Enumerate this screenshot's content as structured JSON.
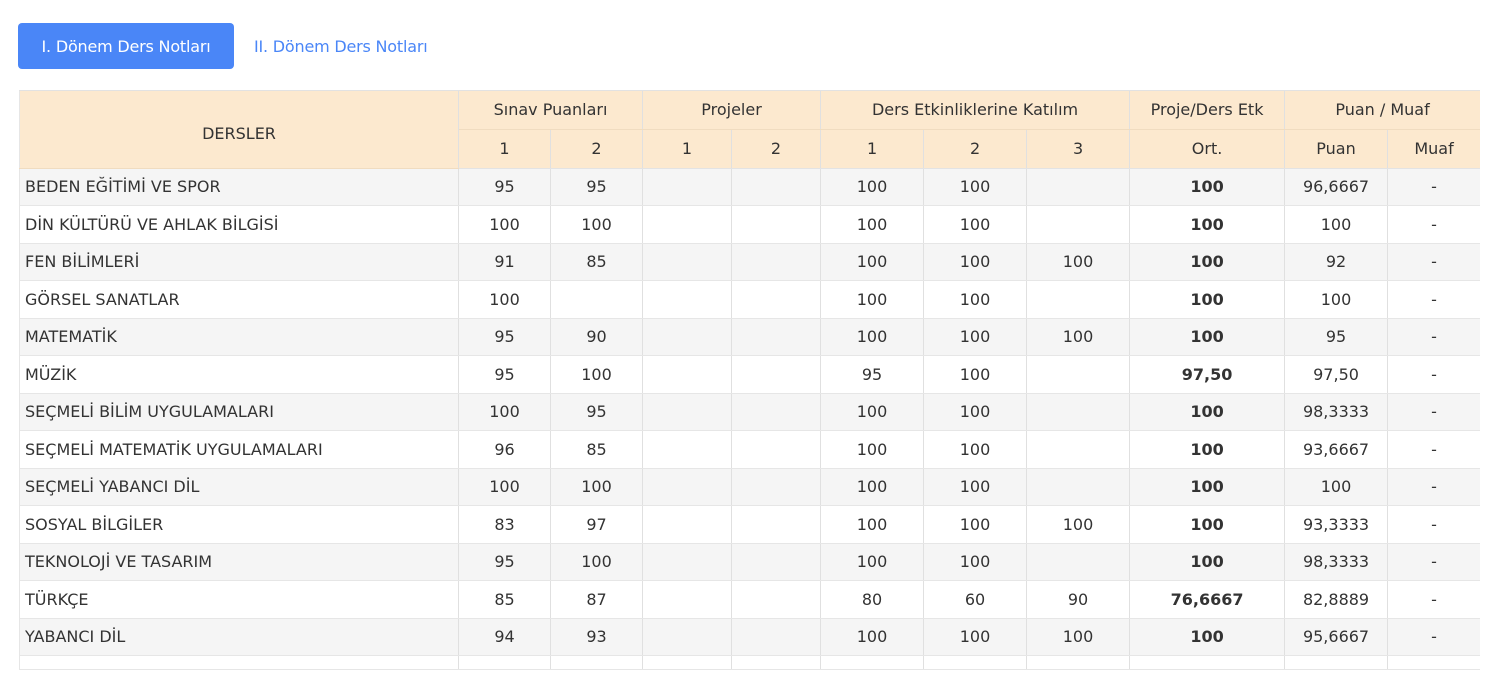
{
  "tabs": {
    "active_label": "I. Dönem Ders Notları",
    "second_label": "II. Dönem Ders Notları"
  },
  "colors": {
    "accent": "#4a86f7",
    "header_bg": "#fce9cf",
    "row_alt": "#f5f5f5"
  },
  "table": {
    "headers": {
      "dersler": "DERSLER",
      "sinav": "Sınav Puanları",
      "projeler": "Projeler",
      "etkinlik": "Ders Etkinliklerine Katılım",
      "proje_ders_etk": "Proje/Ders Etk",
      "puan_muaf": "Puan / Muaf",
      "sub": [
        "1",
        "2",
        "1",
        "2",
        "1",
        "2",
        "3",
        "Ort.",
        "Puan",
        "Muaf"
      ]
    },
    "rows": [
      [
        "BEDEN EĞİTİMİ VE SPOR",
        "95",
        "95",
        "",
        "",
        "100",
        "100",
        "",
        "100",
        "96,6667",
        "-"
      ],
      [
        "DİN KÜLTÜRÜ VE AHLAK BİLGİSİ",
        "100",
        "100",
        "",
        "",
        "100",
        "100",
        "",
        "100",
        "100",
        "-"
      ],
      [
        "FEN BİLİMLERİ",
        "91",
        "85",
        "",
        "",
        "100",
        "100",
        "100",
        "100",
        "92",
        "-"
      ],
      [
        "GÖRSEL SANATLAR",
        "100",
        "",
        "",
        "",
        "100",
        "100",
        "",
        "100",
        "100",
        "-"
      ],
      [
        "MATEMATİK",
        "95",
        "90",
        "",
        "",
        "100",
        "100",
        "100",
        "100",
        "95",
        "-"
      ],
      [
        "MÜZİK",
        "95",
        "100",
        "",
        "",
        "95",
        "100",
        "",
        "97,50",
        "97,50",
        "-"
      ],
      [
        "SEÇMELİ BİLİM UYGULAMALARI",
        "100",
        "95",
        "",
        "",
        "100",
        "100",
        "",
        "100",
        "98,3333",
        "-"
      ],
      [
        "SEÇMELİ MATEMATİK UYGULAMALARI",
        "96",
        "85",
        "",
        "",
        "100",
        "100",
        "",
        "100",
        "93,6667",
        "-"
      ],
      [
        "SEÇMELİ YABANCI DİL",
        "100",
        "100",
        "",
        "",
        "100",
        "100",
        "",
        "100",
        "100",
        "-"
      ],
      [
        "SOSYAL BİLGİLER",
        "83",
        "97",
        "",
        "",
        "100",
        "100",
        "100",
        "100",
        "93,3333",
        "-"
      ],
      [
        "TEKNOLOJİ VE TASARIM",
        "95",
        "100",
        "",
        "",
        "100",
        "100",
        "",
        "100",
        "98,3333",
        "-"
      ],
      [
        "TÜRKÇE",
        "85",
        "87",
        "",
        "",
        "80",
        "60",
        "90",
        "76,6667",
        "82,8889",
        "-"
      ],
      [
        "YABANCI DİL",
        "94",
        "93",
        "",
        "",
        "100",
        "100",
        "100",
        "100",
        "95,6667",
        "-"
      ]
    ]
  }
}
